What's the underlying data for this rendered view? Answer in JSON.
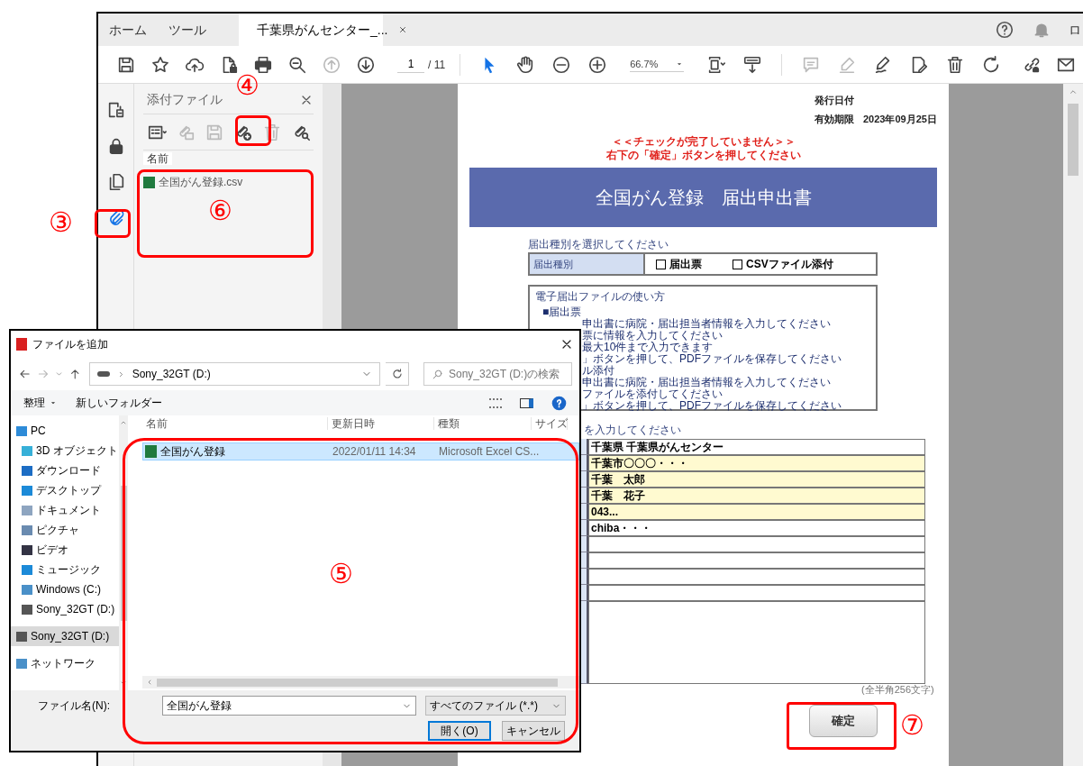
{
  "app": {
    "tabs": [
      {
        "label": "ホーム",
        "selected": false,
        "closable": false
      },
      {
        "label": "ツール",
        "selected": false,
        "closable": false
      },
      {
        "label": "千葉県がんセンター_...",
        "selected": true,
        "closable": true
      }
    ],
    "account": "ロ"
  },
  "toolbar": {
    "file_buttons": [
      {
        "disabled": false
      },
      {
        "disabled": false
      },
      {
        "disabled": false
      },
      {
        "disabled": false
      },
      {
        "disabled": false
      },
      {
        "disabled": false
      },
      {
        "disabled": true
      },
      {
        "disabled": false
      }
    ],
    "page": "1",
    "page_count": "/ 11",
    "view_buttons": [
      {
        "selected": true
      },
      {
        "selected": false
      },
      {
        "selected": false
      },
      {
        "selected": false
      }
    ],
    "zoom": "66.7%",
    "tool_buttons": [
      {
        "disabled": false
      },
      {
        "disabled": false
      },
      {
        "disabled": true
      },
      {
        "disabled": true
      },
      {
        "disabled": false
      },
      {
        "disabled": false
      },
      {
        "disabled": false
      },
      {
        "disabled": false
      }
    ],
    "share_buttons": [
      {
        "disabled": false
      },
      {
        "disabled": false
      }
    ]
  },
  "side_rail": [
    {
      "selected": false
    },
    {
      "selected": false
    },
    {
      "selected": false
    },
    {
      "selected": true
    }
  ],
  "attachments_panel": {
    "title": "添付ファイル",
    "tools": [
      {
        "disabled": false
      },
      {
        "disabled": true
      },
      {
        "disabled": true
      },
      {
        "disabled": false
      },
      {
        "disabled": true
      },
      {
        "disabled": false
      }
    ],
    "column": "名前",
    "files": [
      "全国がん登録.csv"
    ]
  },
  "document": {
    "issue_label": "発行日付",
    "expiry_label": "有効期限",
    "expiry_date": "2023年09月25日",
    "warning": [
      "＜＜チェックが完了していません＞＞",
      "右下の「確定」ボタンを押してください"
    ],
    "banner": "全国がん登録　届出申出書",
    "type_section": {
      "heading": "届出種別を選択してください",
      "label": "届出種別",
      "options": [
        {
          "label": "届出票",
          "checked": false
        },
        {
          "label": "CSVファイル添付",
          "checked": false
        }
      ]
    },
    "howto": {
      "title": "電子届出ファイルの使い方",
      "lines": [
        "■届出票",
        "申出書に病院・届出担当者情報を入力してください",
        "票に情報を入力してください",
        "最大10件まで入力できます",
        "」ボタンを押して、PDFファイルを保存してください",
        "ル添付",
        "申出書に病院・届出担当者情報を入力してください",
        "ファイルを添付してください",
        "」ボタンを押して、PDFファイルを保存してください"
      ]
    },
    "entry_heading": "を入力してください",
    "fields": [
      {
        "kind": "line",
        "value": "千葉県 千葉県がんセンター",
        "highlighted": false
      },
      {
        "kind": "line",
        "value": "千葉市〇〇〇・・・",
        "highlighted": true
      },
      {
        "kind": "line",
        "value": "千葉　太郎",
        "highlighted": true
      },
      {
        "kind": "line",
        "value": "千葉　花子",
        "highlighted": true
      },
      {
        "kind": "line",
        "value": "043...",
        "highlighted": true
      },
      {
        "kind": "line",
        "value": "chiba・・・",
        "highlighted": false
      },
      {
        "kind": "line",
        "highlighted": false
      },
      {
        "kind": "line",
        "highlighted": false
      },
      {
        "kind": "line",
        "highlighted": false
      },
      {
        "kind": "line",
        "highlighted": false
      },
      {
        "kind": "textarea",
        "highlighted": false
      }
    ],
    "note": "(全半角256文字)",
    "confirm_button": "確定"
  },
  "dialog": {
    "title": "ファイルを追加",
    "address": "Sony_32GT (D:)",
    "search_placeholder": "Sony_32GT (D:)の検索",
    "organize": "整理",
    "new_folder": "新しいフォルダー",
    "nav": [
      {
        "label": "PC",
        "selected": false,
        "children": [
          {
            "label": "3D オブジェクト",
            "selected": false
          },
          {
            "label": "ダウンロード",
            "selected": false
          },
          {
            "label": "デスクトップ",
            "selected": false
          },
          {
            "label": "ドキュメント",
            "selected": false
          },
          {
            "label": "ピクチャ",
            "selected": false
          },
          {
            "label": "ビデオ",
            "selected": false
          },
          {
            "label": "ミュージック",
            "selected": false
          },
          {
            "label": "Windows (C:)",
            "selected": false
          },
          {
            "label": "Sony_32GT (D:)",
            "selected": false
          }
        ]
      },
      {
        "label": "Sony_32GT (D:)",
        "selected": true
      },
      {
        "label": "ネットワーク",
        "selected": false
      }
    ],
    "columns": [
      "名前",
      "更新日時",
      "種類",
      "サイズ"
    ],
    "files": [
      {
        "name": "全国がん登録",
        "date": "2022/01/11 14:34",
        "type": "Microsoft Excel CS...",
        "selected": true
      }
    ],
    "filename_label": "ファイル名(N):",
    "filename": "全国がん登録",
    "filter": "すべてのファイル (*.*)",
    "buttons": [
      {
        "label": "開く(O)",
        "default": true
      },
      {
        "label": "キャンセル",
        "default": false
      }
    ]
  },
  "annotations": [
    {
      "label": "③"
    },
    {
      "label": "④"
    },
    {
      "label": "⑥"
    },
    {
      "label": "⑤"
    },
    {
      "label": "⑦"
    }
  ]
}
